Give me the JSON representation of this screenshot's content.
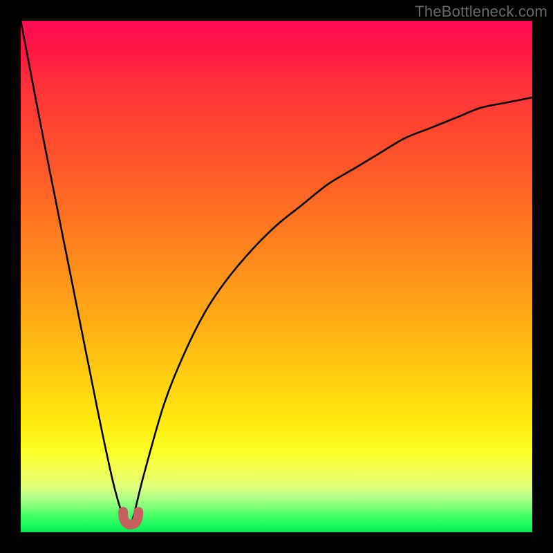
{
  "attribution": "TheBottleneck.com",
  "chart_data": {
    "type": "line",
    "title": "",
    "xlabel": "",
    "ylabel": "",
    "x_range": [
      0,
      100
    ],
    "y_range": [
      0,
      100
    ],
    "gradient_meaning": "bottleneck severity (red high, green low)",
    "curve_description": "abs-difference style bottleneck curve; zero at x≈21 then rising asymptotically toward ~85",
    "x": [
      0,
      5,
      10,
      15,
      18,
      20,
      21,
      22,
      24,
      28,
      32,
      36,
      40,
      45,
      50,
      55,
      60,
      65,
      70,
      75,
      80,
      85,
      90,
      95,
      100
    ],
    "y": [
      100,
      74,
      49,
      24,
      10,
      3,
      1,
      3,
      11,
      25,
      35,
      43,
      49,
      55,
      60,
      64,
      68,
      71,
      74,
      77,
      79,
      81,
      83,
      84,
      85
    ],
    "optimal_region": {
      "x_start": 20,
      "x_end": 23,
      "y": 1.5
    },
    "marker_color": "#c6605f"
  }
}
